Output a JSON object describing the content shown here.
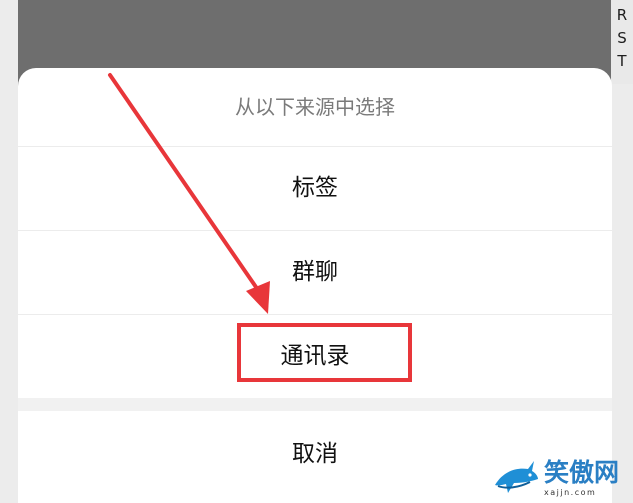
{
  "index_bar": {
    "letters": [
      "R",
      "S",
      "T"
    ]
  },
  "sheet": {
    "title": "从以下来源中选择",
    "options": [
      {
        "label": "标签"
      },
      {
        "label": "群聊"
      },
      {
        "label": "通讯录"
      }
    ],
    "cancel_label": "取消"
  },
  "annotation": {
    "color": "#e8363a",
    "highlighted_option": "通讯录"
  },
  "watermark": {
    "icon": "shark-logo-icon",
    "name": "笑傲网",
    "url": "xajjn.com"
  }
}
